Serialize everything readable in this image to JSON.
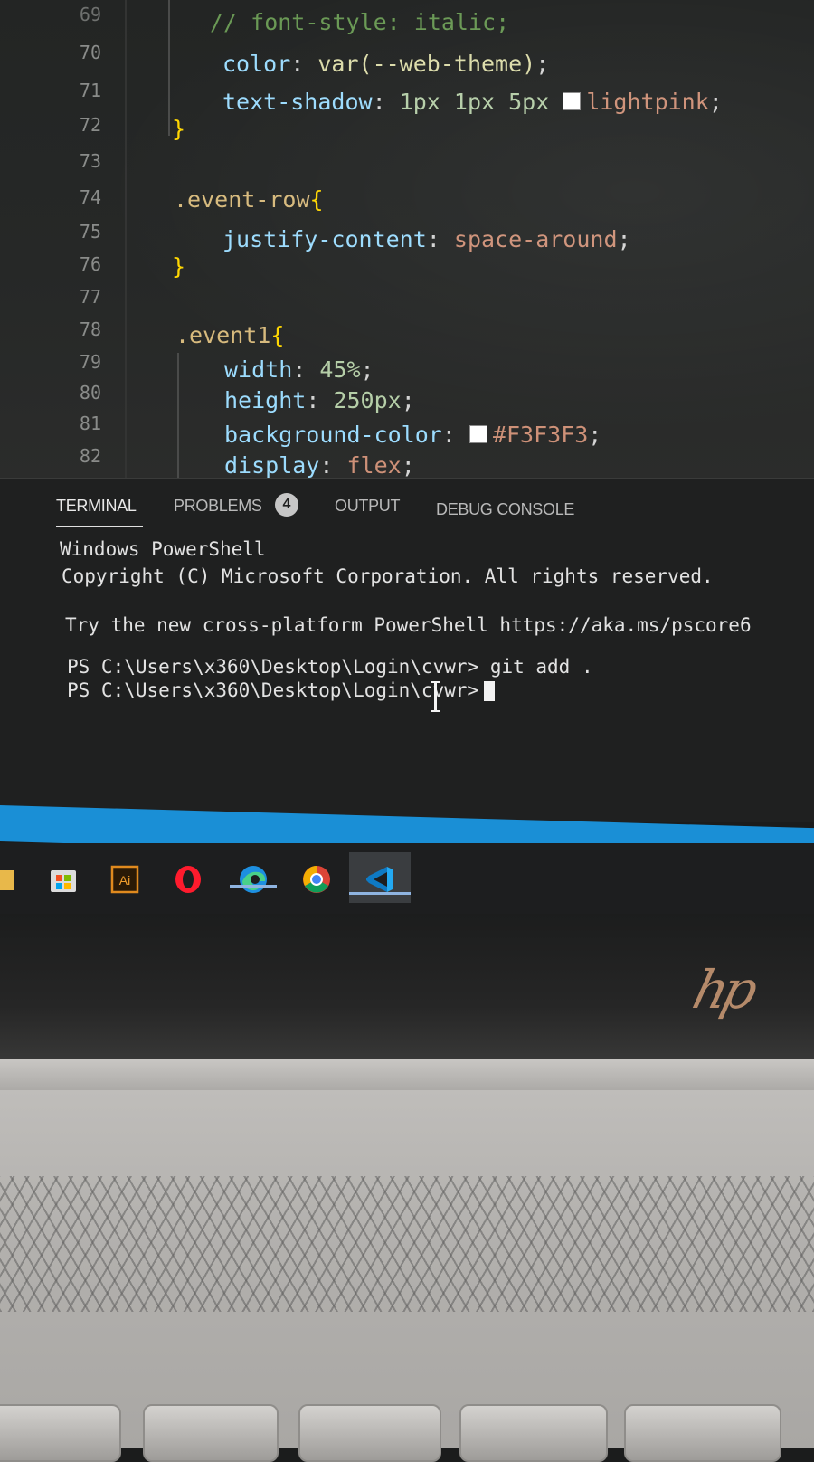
{
  "editor": {
    "line_numbers": [
      "69",
      "70",
      "71",
      "72",
      "73",
      "74",
      "75",
      "76",
      "77",
      "78",
      "79",
      "80",
      "81",
      "82"
    ],
    "lines": {
      "l69": "// font-style: italic;",
      "l70_prop": "color",
      "l70_val": "var(--web-theme)",
      "l71_prop": "text-shadow",
      "l71_val1": "1px 1px 5px",
      "l71_val2": "lightpink",
      "l72": "}",
      "l74_sel": ".event-row",
      "l75_prop": "justify-content",
      "l75_val": "space-around",
      "l76": "}",
      "l78_sel": ".event1",
      "l79_prop": "width",
      "l79_val": "45%",
      "l80_prop": "height",
      "l80_val": "250px",
      "l81_prop": "background-color",
      "l81_val": "#F3F3F3",
      "l82_prop": "display",
      "l82_val": "flex"
    },
    "swatch_colors": {
      "lightpink": "#ffffff",
      "f3f3f3": "#ffffff"
    }
  },
  "panel": {
    "tabs": {
      "terminal": "TERMINAL",
      "problems": "PROBLEMS",
      "problems_count": "4",
      "output": "OUTPUT",
      "debug_console": "DEBUG CONSOLE"
    },
    "terminal": {
      "line1": "Windows PowerShell",
      "line2": "Copyright (C) Microsoft Corporation. All rights reserved.",
      "line3": "Try the new cross-platform PowerShell https://aka.ms/pscore6",
      "prompt1": "PS C:\\Users\\x360\\Desktop\\Login\\cvwr>",
      "command1": "git add .",
      "prompt2": "PS C:\\Users\\x360\\Desktop\\Login\\cvwr>"
    }
  },
  "taskbar": {
    "icons": [
      "file-explorer-icon",
      "microsoft-store-icon",
      "adobe-illustrator-icon",
      "opera-icon",
      "edge-icon",
      "chrome-icon",
      "vscode-icon"
    ],
    "illustrator_label": "Ai",
    "accent": "#1a8fd6"
  }
}
